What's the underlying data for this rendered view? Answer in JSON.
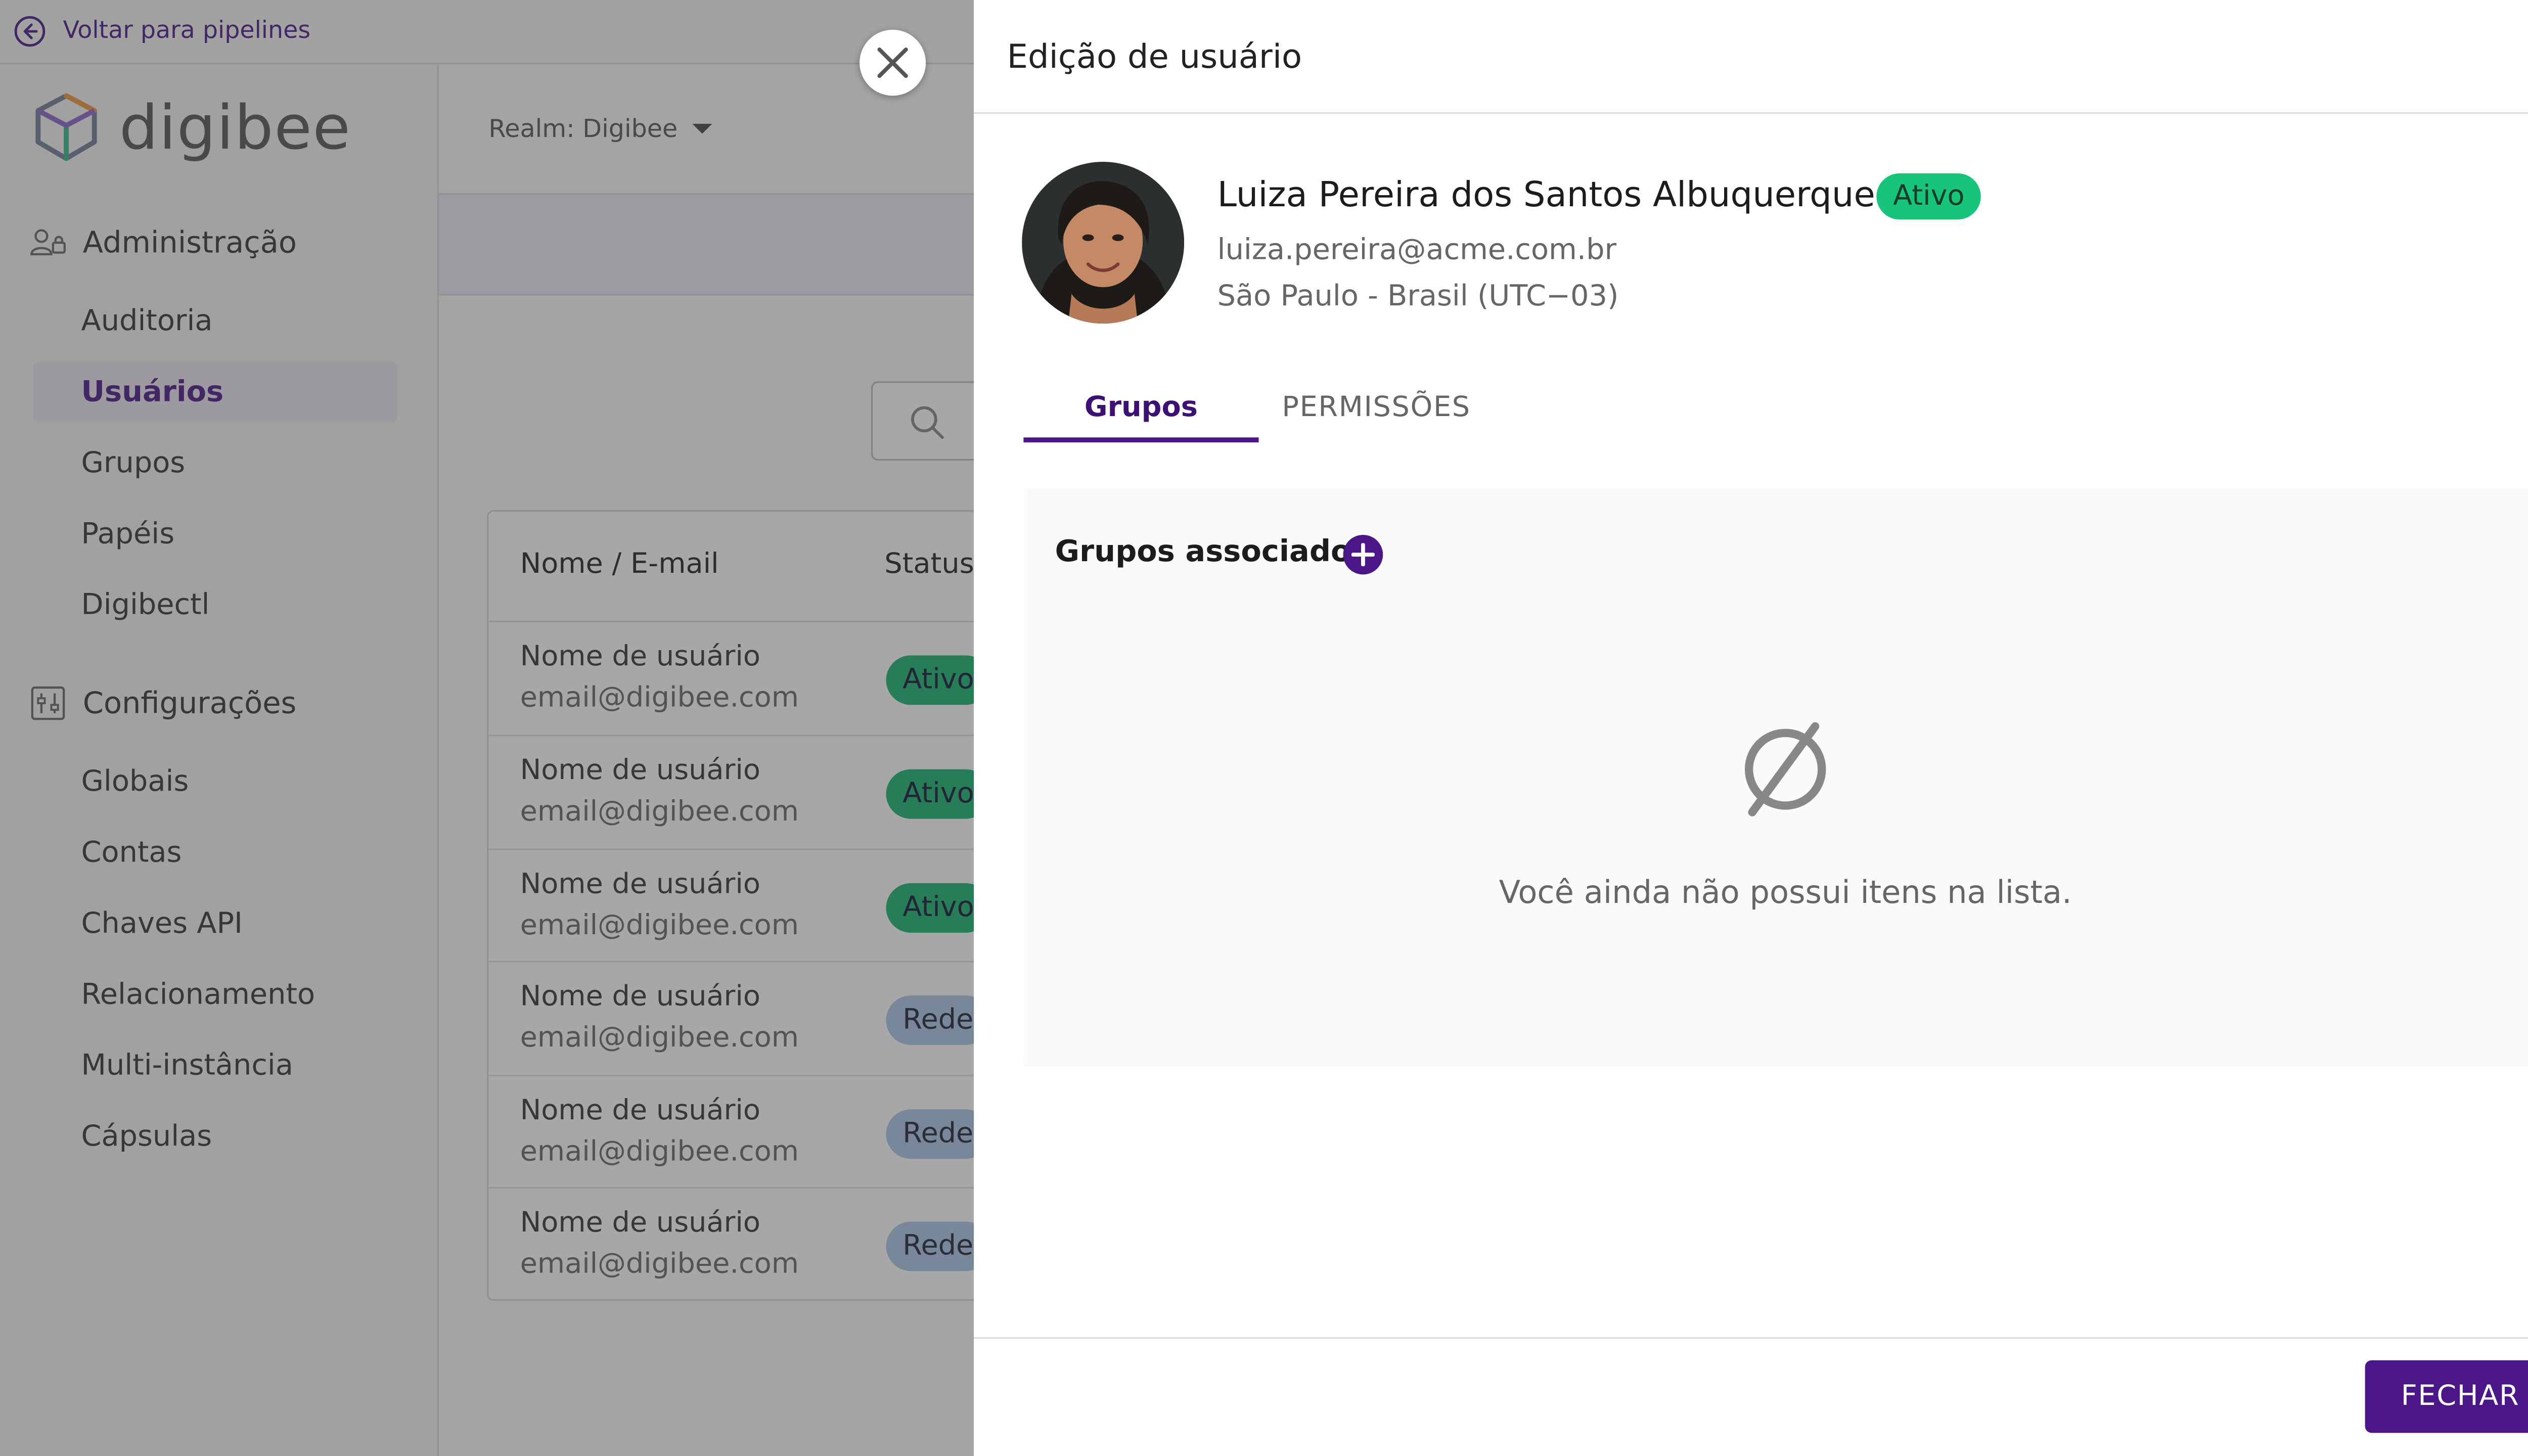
{
  "topbar": {
    "back_label": "Voltar para pipelines"
  },
  "brand": {
    "name": "digibee"
  },
  "sidebar": {
    "admin_section": "Administração",
    "admin_items": [
      {
        "label": "Auditoria"
      },
      {
        "label": "Usuários",
        "active": true
      },
      {
        "label": "Grupos"
      },
      {
        "label": "Papéis"
      },
      {
        "label": "Digibectl"
      }
    ],
    "config_section": "Configurações",
    "config_items": [
      {
        "label": "Globais"
      },
      {
        "label": "Contas"
      },
      {
        "label": "Chaves API"
      },
      {
        "label": "Relacionamento"
      },
      {
        "label": "Multi-instância"
      },
      {
        "label": "Cápsulas"
      }
    ]
  },
  "main": {
    "realm_label": "Realm: Digibee"
  },
  "table": {
    "headers": {
      "name": "Nome / E-mail",
      "status": "Status"
    },
    "rows": [
      {
        "name": "Nome de usuário",
        "email": "email@digibee.com",
        "status": "Ativo"
      },
      {
        "name": "Nome de usuário",
        "email": "email@digibee.com",
        "status": "Ativo"
      },
      {
        "name": "Nome de usuário",
        "email": "email@digibee.com",
        "status": "Ativo"
      },
      {
        "name": "Nome de usuário",
        "email": "email@digibee.com",
        "status": "Rede"
      },
      {
        "name": "Nome de usuário",
        "email": "email@digibee.com",
        "status": "Rede"
      },
      {
        "name": "Nome de usuário",
        "email": "email@digibee.com",
        "status": "Rede"
      }
    ]
  },
  "drawer": {
    "title": "Edição de usuário",
    "user": {
      "name": "Luiza Pereira dos Santos Albuquerque",
      "status": "Ativo",
      "email": "luiza.pereira@acme.com.br",
      "location": "São Paulo - Brasil (UTC−03)"
    },
    "tabs": [
      {
        "label": "Grupos",
        "active": true
      },
      {
        "label": "PERMISSÕES"
      }
    ],
    "groups_title": "Grupos associados",
    "empty_message": "Você ainda não possui itens na lista.",
    "close_label": "FECHAR"
  },
  "colors": {
    "primary": "#4a1688",
    "active_chip": "#17c47a",
    "inactive_chip": "#a9c7e8"
  },
  "icons": [
    "arrow-left-circle-icon",
    "digibee-cube-logo-icon",
    "admin-users-icon",
    "settings-sliders-icon",
    "caret-down-icon",
    "search-icon",
    "close-icon",
    "plus-icon",
    "empty-set-icon"
  ]
}
